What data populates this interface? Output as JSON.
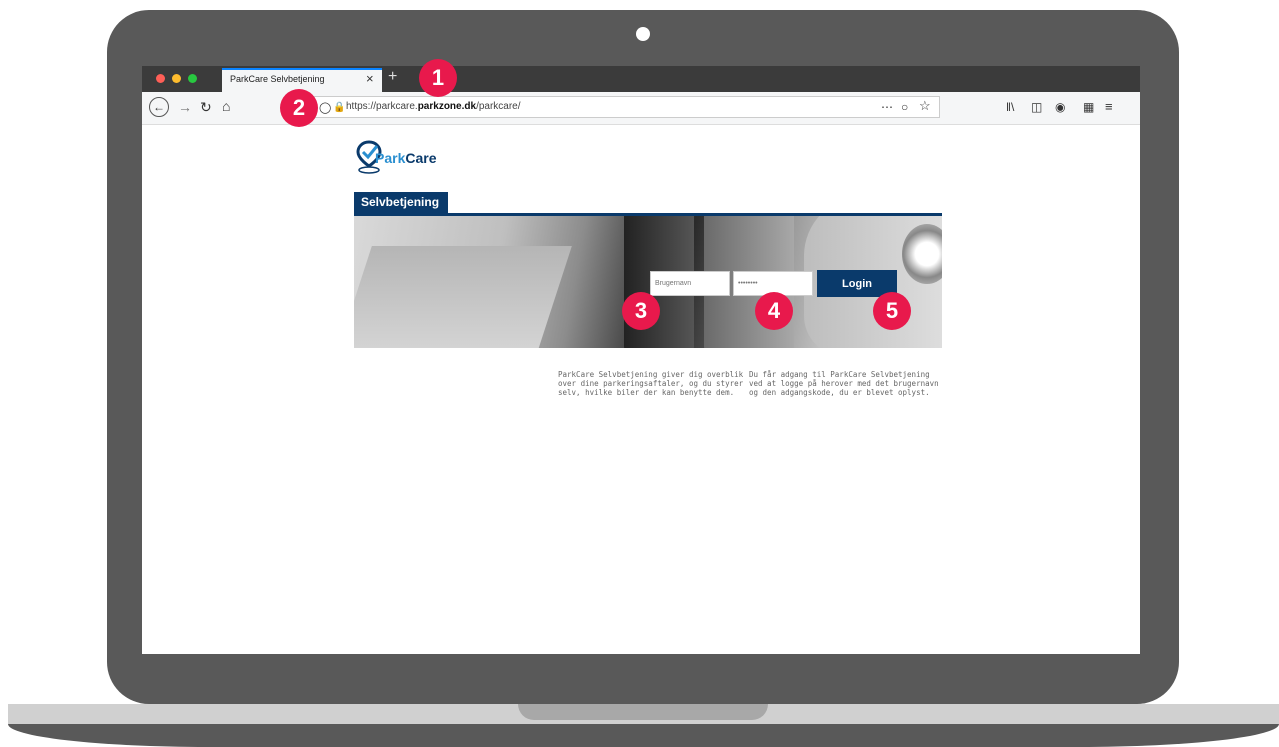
{
  "browser": {
    "tab_title": "ParkCare Selvbetjening",
    "tab_close": "×",
    "new_tab": "+",
    "url_prefix": "https://parkcare.",
    "url_domain": "parkzone.dk",
    "url_path": "/parkcare/",
    "toolbar_icons": [
      "back-icon",
      "forward-icon",
      "reload-icon",
      "home-icon",
      "shield-icon",
      "lock-icon",
      "more-icon",
      "pocket-icon",
      "star-icon",
      "library-icon",
      "sidebar-icon",
      "account-icon",
      "extension-icon",
      "menu-icon"
    ]
  },
  "page": {
    "logo_text": "ParkCare",
    "logo_park": "Park",
    "logo_care": "Care",
    "section_tab": "Selvbetjening",
    "login": {
      "username_placeholder": "Brugernavn",
      "password_value": "••••••••",
      "login_button": "Login"
    },
    "info_left": "ParkCare Selvbetjening giver dig overblik over dine parkeringsaftaler, og du styrer selv, hvilke biler der kan benytte dem.",
    "info_right": "Du får adgang til ParkCare Selvbetjening ved at logge på herover med det brugernavn og den adgangskode, du er blevet oplyst."
  },
  "markers": [
    "1",
    "2",
    "3",
    "4",
    "5"
  ],
  "colors": {
    "brand_navy": "#0a3a6b",
    "marker_red": "#e8194c",
    "laptop_gray": "#595959",
    "logo_blue": "#2a8fd0"
  }
}
